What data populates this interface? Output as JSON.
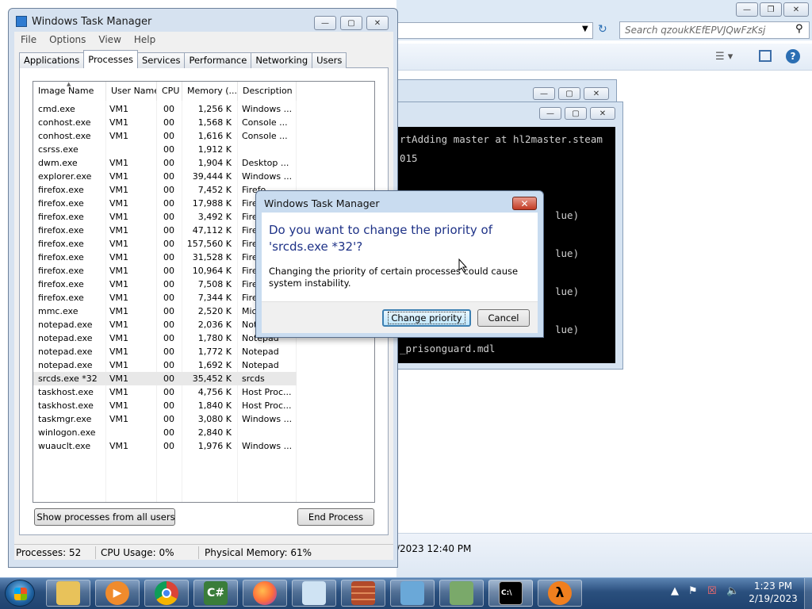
{
  "explorer": {
    "search_placeholder": "Search qzoukKEfEPVJQwFzKsj",
    "status_text": "/2023 12:40 PM"
  },
  "console": {
    "lines": [
      "rtAdding master at hl2master.steam",
      "015",
      "lue)",
      "lue)",
      "lue)",
      "lue)",
      "_prisonguard.mdl"
    ]
  },
  "task_manager": {
    "title": "Windows Task Manager",
    "menu": [
      "File",
      "Options",
      "View",
      "Help"
    ],
    "tabs": [
      "Applications",
      "Processes",
      "Services",
      "Performance",
      "Networking",
      "Users"
    ],
    "active_tab": "Processes",
    "columns": [
      "Image Name",
      "User Name",
      "CPU",
      "Memory (...",
      "Description"
    ],
    "processes": [
      {
        "name": "cmd.exe",
        "user": "VM1",
        "cpu": "00",
        "mem": "1,256 K",
        "desc": "Windows ..."
      },
      {
        "name": "conhost.exe",
        "user": "VM1",
        "cpu": "00",
        "mem": "1,568 K",
        "desc": "Console ..."
      },
      {
        "name": "conhost.exe",
        "user": "VM1",
        "cpu": "00",
        "mem": "1,616 K",
        "desc": "Console ..."
      },
      {
        "name": "csrss.exe",
        "user": "",
        "cpu": "00",
        "mem": "1,912 K",
        "desc": ""
      },
      {
        "name": "dwm.exe",
        "user": "VM1",
        "cpu": "00",
        "mem": "1,904 K",
        "desc": "Desktop ..."
      },
      {
        "name": "explorer.exe",
        "user": "VM1",
        "cpu": "00",
        "mem": "39,444 K",
        "desc": "Windows ..."
      },
      {
        "name": "firefox.exe",
        "user": "VM1",
        "cpu": "00",
        "mem": "7,452 K",
        "desc": "Firefo"
      },
      {
        "name": "firefox.exe",
        "user": "VM1",
        "cpu": "00",
        "mem": "17,988 K",
        "desc": "Fire"
      },
      {
        "name": "firefox.exe",
        "user": "VM1",
        "cpu": "00",
        "mem": "3,492 K",
        "desc": "Fire"
      },
      {
        "name": "firefox.exe",
        "user": "VM1",
        "cpu": "00",
        "mem": "47,112 K",
        "desc": "Fire"
      },
      {
        "name": "firefox.exe",
        "user": "VM1",
        "cpu": "00",
        "mem": "157,560 K",
        "desc": "Fire"
      },
      {
        "name": "firefox.exe",
        "user": "VM1",
        "cpu": "00",
        "mem": "31,528 K",
        "desc": "Fire"
      },
      {
        "name": "firefox.exe",
        "user": "VM1",
        "cpu": "00",
        "mem": "10,964 K",
        "desc": "Fire"
      },
      {
        "name": "firefox.exe",
        "user": "VM1",
        "cpu": "00",
        "mem": "7,508 K",
        "desc": "Fire"
      },
      {
        "name": "firefox.exe",
        "user": "VM1",
        "cpu": "00",
        "mem": "7,344 K",
        "desc": "Fire"
      },
      {
        "name": "mmc.exe",
        "user": "VM1",
        "cpu": "00",
        "mem": "2,520 K",
        "desc": "Mic"
      },
      {
        "name": "notepad.exe",
        "user": "VM1",
        "cpu": "00",
        "mem": "2,036 K",
        "desc": "Not"
      },
      {
        "name": "notepad.exe",
        "user": "VM1",
        "cpu": "00",
        "mem": "1,780 K",
        "desc": "Notepad"
      },
      {
        "name": "notepad.exe",
        "user": "VM1",
        "cpu": "00",
        "mem": "1,772 K",
        "desc": "Notepad"
      },
      {
        "name": "notepad.exe",
        "user": "VM1",
        "cpu": "00",
        "mem": "1,692 K",
        "desc": "Notepad"
      },
      {
        "name": "srcds.exe *32",
        "user": "VM1",
        "cpu": "00",
        "mem": "35,452 K",
        "desc": "srcds",
        "selected": true
      },
      {
        "name": "taskhost.exe",
        "user": "VM1",
        "cpu": "00",
        "mem": "4,756 K",
        "desc": "Host Proc..."
      },
      {
        "name": "taskhost.exe",
        "user": "VM1",
        "cpu": "00",
        "mem": "1,840 K",
        "desc": "Host Proc..."
      },
      {
        "name": "taskmgr.exe",
        "user": "VM1",
        "cpu": "00",
        "mem": "3,080 K",
        "desc": "Windows ..."
      },
      {
        "name": "winlogon.exe",
        "user": "",
        "cpu": "00",
        "mem": "2,840 K",
        "desc": ""
      },
      {
        "name": "wuauclt.exe",
        "user": "VM1",
        "cpu": "00",
        "mem": "1,976 K",
        "desc": "Windows ..."
      }
    ],
    "show_all_label": "Show processes from all users",
    "end_process_label": "End Process",
    "status": {
      "processes": "Processes: 52",
      "cpu": "CPU Usage: 0%",
      "memory": "Physical Memory: 61%"
    }
  },
  "dialog": {
    "title": "Windows Task Manager",
    "question": "Do you want to change the priority of 'srcds.exe *32'?",
    "warning": "Changing the priority of certain processes could cause system instability.",
    "change_label": "Change priority",
    "cancel_label": "Cancel"
  },
  "taskbar": {
    "apps": [
      "explorer",
      "media-player",
      "chrome",
      "csharp-editor",
      "firefox",
      "notepad",
      "firewall",
      "control-panel",
      "network",
      "command-prompt",
      "half-life-2"
    ],
    "time": "1:23 PM",
    "date": "2/19/2023"
  },
  "colors": {
    "dialog_heading": "#1e3287",
    "taskbar": "#2a4f7d",
    "close_red": "#c23b24"
  }
}
